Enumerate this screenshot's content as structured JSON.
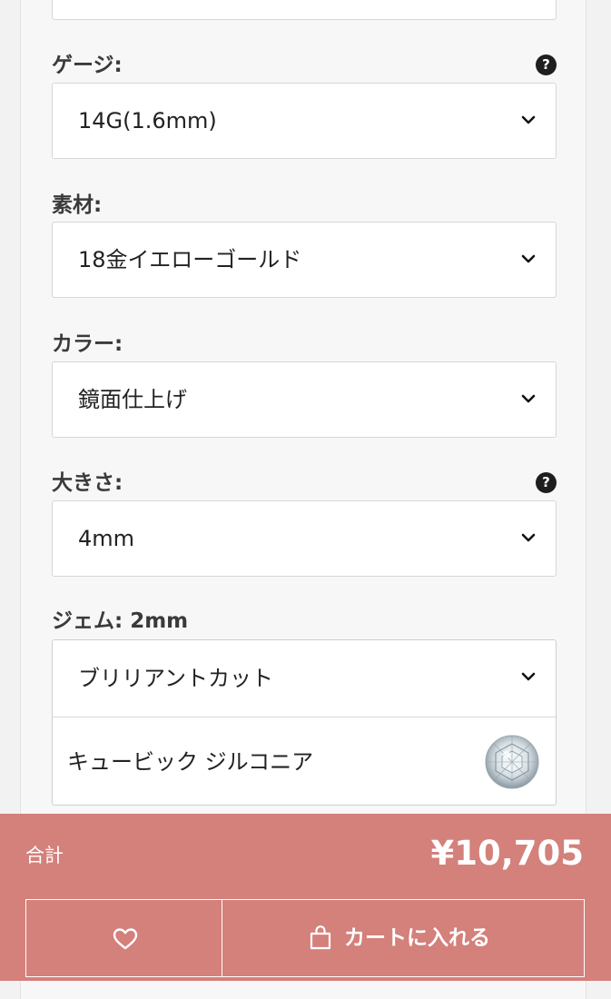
{
  "fields": [
    {
      "label": "ゲージ:",
      "value": "14G(1.6mm)",
      "has_help": true
    },
    {
      "label": "素材:",
      "value": "18金イエローゴールド",
      "has_help": false
    },
    {
      "label": "カラー:",
      "value": "鏡面仕上げ",
      "has_help": false
    },
    {
      "label": "大きさ:",
      "value": "4mm",
      "has_help": true
    }
  ],
  "help_glyph": "?",
  "gem": {
    "label": "ジェム: 2mm",
    "cut_value": "ブリリアントカット",
    "stone_value": "キュービック ジルコニア",
    "stone_icon": "diamond-icon"
  },
  "footer": {
    "total_label": "合計",
    "total_value": "¥10,705",
    "favorite_icon": "heart-icon",
    "cart_icon": "shopping-bag-icon",
    "cart_label": "カートに入れる",
    "background_color": "#d4807b"
  }
}
